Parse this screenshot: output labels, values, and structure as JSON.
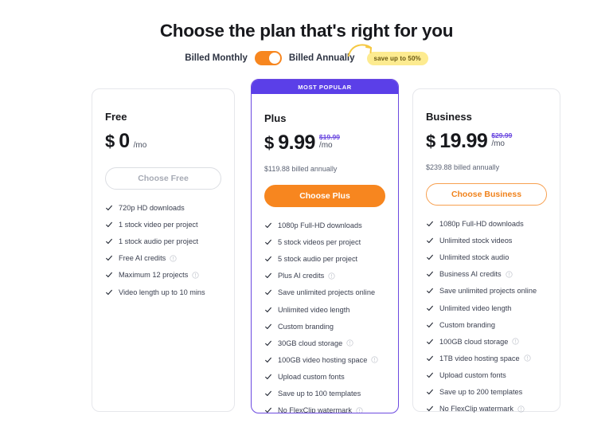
{
  "header": {
    "title": "Choose the plan that's right for you",
    "billing": {
      "monthly_label": "Billed Monthly",
      "annually_label": "Billed Annually",
      "save_badge": "save up to 50%",
      "toggle_state": "annually",
      "toggle_color": "#f7861f",
      "badge_color": "#fdeb90",
      "arrow_icon": "curved-arrow-icon"
    }
  },
  "plans": [
    {
      "name": "Free",
      "badge": null,
      "currency": "$",
      "price": "0",
      "period": "/mo",
      "old_price": null,
      "billed_note": null,
      "cta_label": "Choose Free",
      "cta_style": "outline-grey",
      "features": [
        {
          "text": "720p HD downloads",
          "info": false
        },
        {
          "text": "1 stock video per project",
          "info": false
        },
        {
          "text": "1 stock audio per project",
          "info": false
        },
        {
          "text": "Free AI credits",
          "info": true
        },
        {
          "text": "Maximum 12 projects",
          "info": true
        },
        {
          "text": "Video length up to 10 mins",
          "info": false
        }
      ]
    },
    {
      "name": "Plus",
      "badge": "MOST POPULAR",
      "badge_color": "#5b3fe8",
      "currency": "$",
      "price": "9.99",
      "period": "/mo",
      "old_price": "$19.99",
      "billed_note": "$119.88 billed annually",
      "cta_label": "Choose Plus",
      "cta_style": "solid-orange",
      "features": [
        {
          "text": "1080p Full-HD downloads",
          "info": false
        },
        {
          "text": "5 stock videos per project",
          "info": false
        },
        {
          "text": "5 stock audio per project",
          "info": false
        },
        {
          "text": "Plus AI credits",
          "info": true
        },
        {
          "text": "Save unlimited projects online",
          "info": false
        },
        {
          "text": "Unlimited video length",
          "info": false
        },
        {
          "text": "Custom branding",
          "info": false
        },
        {
          "text": "30GB cloud storage",
          "info": true
        },
        {
          "text": "100GB video hosting space",
          "info": true
        },
        {
          "text": "Upload custom fonts",
          "info": false
        },
        {
          "text": "Save up to 100 templates",
          "info": false
        },
        {
          "text": "No FlexClip watermark",
          "info": true
        }
      ]
    },
    {
      "name": "Business",
      "badge": null,
      "currency": "$",
      "price": "19.99",
      "period": "/mo",
      "old_price": "$29.99",
      "billed_note": "$239.88 billed annually",
      "cta_label": "Choose Business",
      "cta_style": "outline-orange",
      "features": [
        {
          "text": "1080p Full-HD downloads",
          "info": false
        },
        {
          "text": "Unlimited stock videos",
          "info": false
        },
        {
          "text": "Unlimited stock audio",
          "info": false
        },
        {
          "text": "Business AI credits",
          "info": true
        },
        {
          "text": "Save unlimited projects online",
          "info": false
        },
        {
          "text": "Unlimited video length",
          "info": false
        },
        {
          "text": "Custom branding",
          "info": false
        },
        {
          "text": "100GB cloud storage",
          "info": true
        },
        {
          "text": "1TB video hosting space",
          "info": true
        },
        {
          "text": "Upload custom fonts",
          "info": false
        },
        {
          "text": "Save up to 200 templates",
          "info": false
        },
        {
          "text": "No FlexClip watermark",
          "info": true
        }
      ]
    }
  ]
}
